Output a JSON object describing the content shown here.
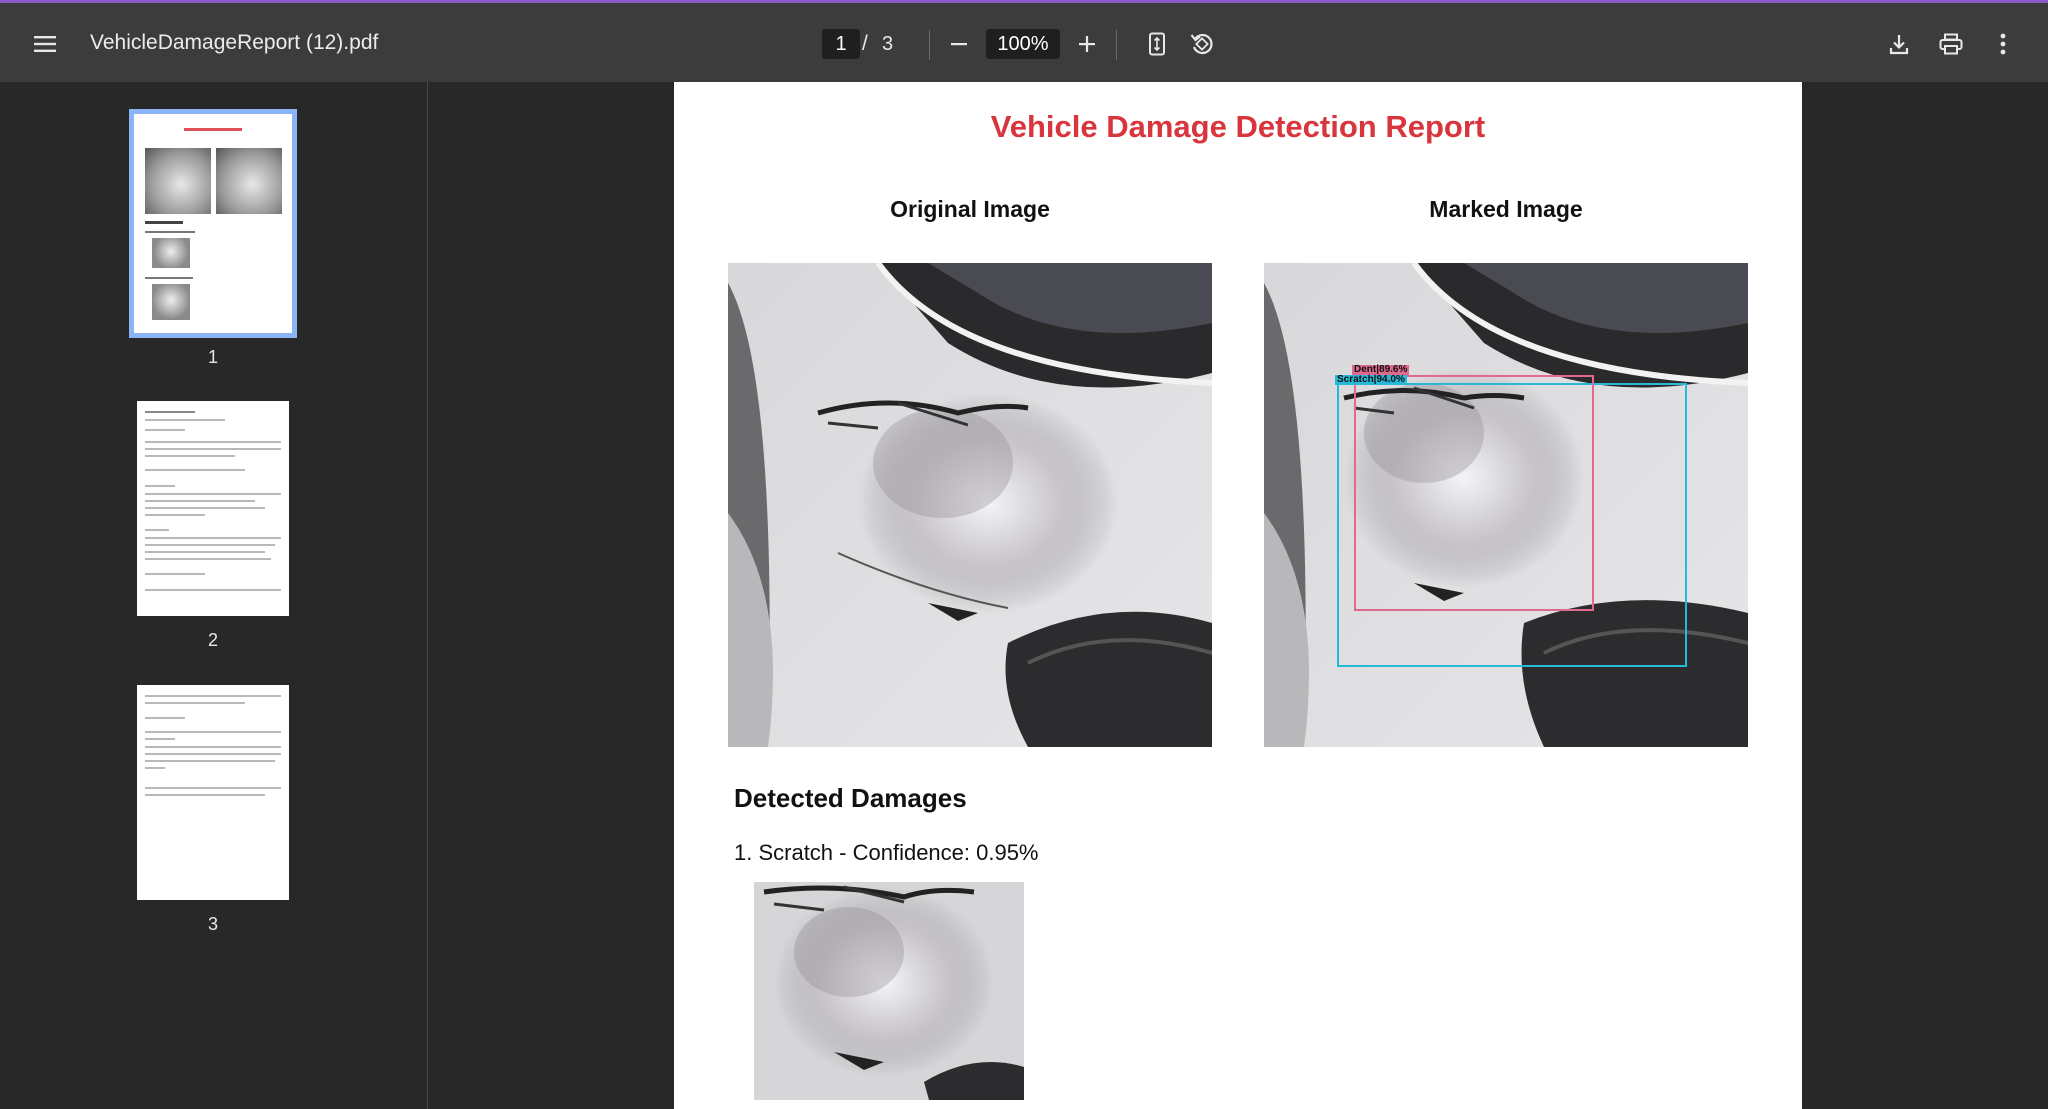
{
  "toolbar": {
    "title": "VehicleDamageReport (12).pdf",
    "current_page": "1",
    "page_separator": "/",
    "total_pages": "3",
    "zoom": "100%"
  },
  "sidebar": {
    "thumbnails": [
      {
        "number": "1",
        "selected": true
      },
      {
        "number": "2",
        "selected": false
      },
      {
        "number": "3",
        "selected": false
      }
    ]
  },
  "report": {
    "title": "Vehicle Damage Detection Report",
    "original_heading": "Original Image",
    "marked_heading": "Marked Image",
    "detections": [
      {
        "label": "Dent|89.6%",
        "color": "#e06a8f"
      },
      {
        "label": "Scratch|94.0%",
        "color": "#28b8d8"
      }
    ],
    "detected_heading": "Detected Damages",
    "damages": [
      {
        "text": "1. Scratch - Confidence: 0.95%"
      }
    ]
  },
  "colors": {
    "accent_title": "#d9353d",
    "thumb_selected": "#8ab4f8",
    "toolbar_bg": "#3c3c3c",
    "viewer_bg": "#282828"
  }
}
